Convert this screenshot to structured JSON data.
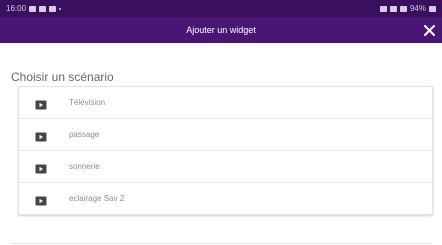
{
  "status_bar": {
    "time": "16:00",
    "battery": "94%"
  },
  "app_bar": {
    "title": "Ajouter un widget",
    "close_icon": "close-icon"
  },
  "section": {
    "heading": "Choisir un scénario"
  },
  "scenarios": [
    {
      "label": "Télévision",
      "icon": "scenario-icon"
    },
    {
      "label": "passage",
      "icon": "scenario-icon"
    },
    {
      "label": "sonnerie",
      "icon": "scenario-icon"
    },
    {
      "label": "eclairage Sav 2",
      "icon": "scenario-icon"
    }
  ],
  "colors": {
    "status_bar_bg": "#3a0f5e",
    "app_bar_bg": "#4a1676"
  }
}
